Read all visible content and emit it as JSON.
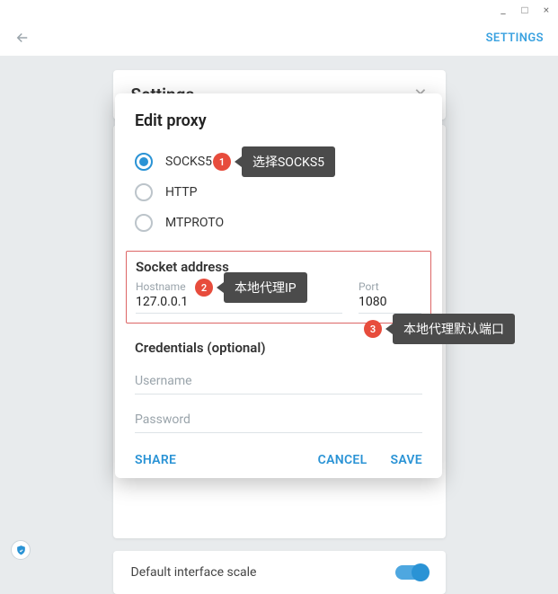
{
  "window": {
    "minimize": "_",
    "maximize": "□",
    "close": "×"
  },
  "topbar": {
    "settings_link": "SETTINGS"
  },
  "settings_panel": {
    "title": "Settings",
    "default_scale_label": "Default interface scale"
  },
  "modal": {
    "title": "Edit proxy",
    "proxy_types": {
      "socks5": "SOCKS5",
      "http": "HTTP",
      "mtproto": "MTPROTO"
    },
    "selected_type": "socks5",
    "socket_address": {
      "title": "Socket address",
      "hostname_label": "Hostname",
      "hostname_value": "127.0.0.1",
      "port_label": "Port",
      "port_value": "1080"
    },
    "credentials": {
      "title": "Credentials (optional)",
      "username_placeholder": "Username",
      "password_placeholder": "Password"
    },
    "actions": {
      "share": "SHARE",
      "cancel": "CANCEL",
      "save": "SAVE"
    }
  },
  "annotations": {
    "a1": {
      "num": "1",
      "tip": "选择SOCKS5"
    },
    "a2": {
      "num": "2",
      "tip": "本地代理IP"
    },
    "a3": {
      "num": "3",
      "tip": "本地代理默认端口"
    }
  }
}
